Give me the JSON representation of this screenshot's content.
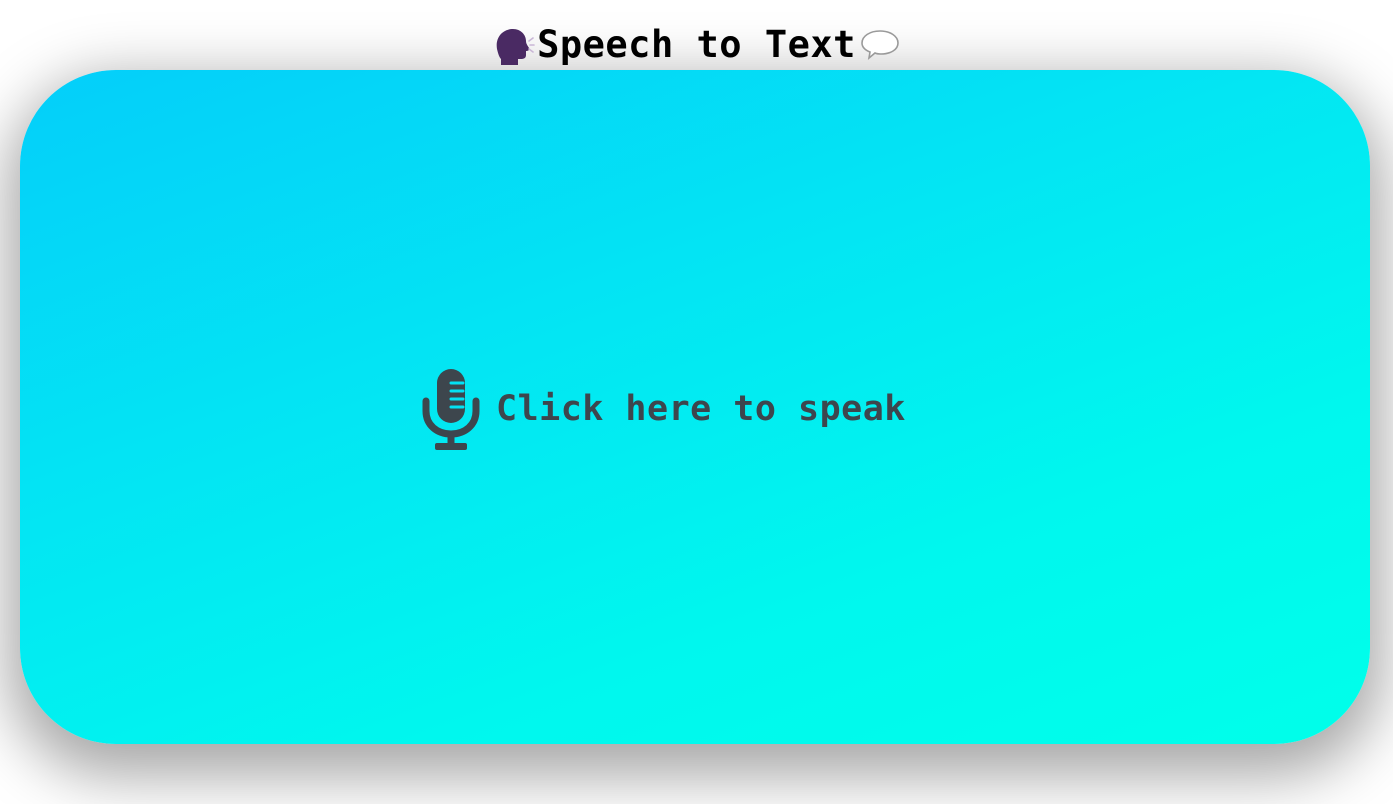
{
  "header": {
    "title": "Speech to Text",
    "left_icon": "speaking-head-icon",
    "right_icon": "speech-balloon-icon"
  },
  "card": {
    "button_label": "Click here to speak",
    "button_icon": "microphone-icon"
  },
  "colors": {
    "gradient_start": "#04cefa",
    "gradient_end": "#00ffea",
    "label_color": "#3d464d",
    "title_color": "#000000",
    "head_icon_color": "#4a2a63"
  }
}
